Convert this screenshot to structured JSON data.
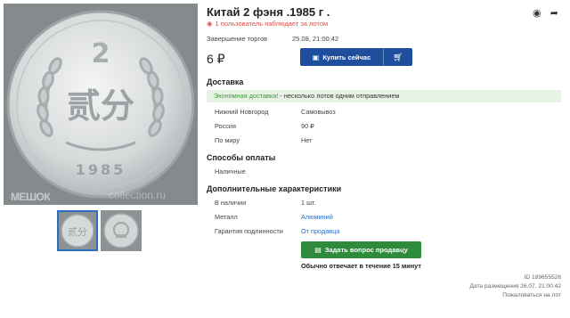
{
  "listing": {
    "title": "Китай 2 фэня .1985 г .",
    "watchers": "1 пользователь наблюдает за лотом",
    "end_label": "Завершение торгов",
    "end_value": "25.08, 21:00:42",
    "price": "6 ₽",
    "buy_label": "Купить сейчас"
  },
  "gallery": {
    "watermark_left": "МЕШОК",
    "watermark_right": "collection.ru",
    "coin_top": "2",
    "coin_center": "贰分",
    "coin_year": "1985"
  },
  "delivery": {
    "heading": "Доставка",
    "promo_green": "Экономная доставка!",
    "promo_rest": " - несколько лотов одним отправлением",
    "rows": [
      {
        "label": "Нижний Новгород",
        "value": "Самовывоз"
      },
      {
        "label": "Россия",
        "value": "90 ₽"
      },
      {
        "label": "По миру",
        "value": "Нет"
      }
    ]
  },
  "payment": {
    "heading": "Способы оплаты",
    "method": "Наличные"
  },
  "specs": {
    "heading": "Дополнительные характеристики",
    "rows": [
      {
        "label": "В наличии",
        "value": "1 шт."
      },
      {
        "label": "Металл",
        "value": "Алюминий"
      },
      {
        "label": "Гарантия подлинности",
        "value": "От продавца"
      }
    ]
  },
  "seller": {
    "ask_label": "Задать вопрос продавцу",
    "reply_note": "Обычно отвечает в течение 15 минут"
  },
  "meta": {
    "id": "ID 189655526",
    "placed": "Дата размещения 26.07, 21:00:42",
    "report": "Пожаловаться на лот"
  },
  "colors": {
    "primary": "#1f4f9c",
    "success": "#2e8b3c",
    "promo_bg": "#e8f3e6",
    "link": "#2b6fc2",
    "alert": "#d9534f"
  },
  "icons": [
    "eye-icon",
    "share-icon",
    "briefcase-icon",
    "cart-icon",
    "chat-icon"
  ]
}
